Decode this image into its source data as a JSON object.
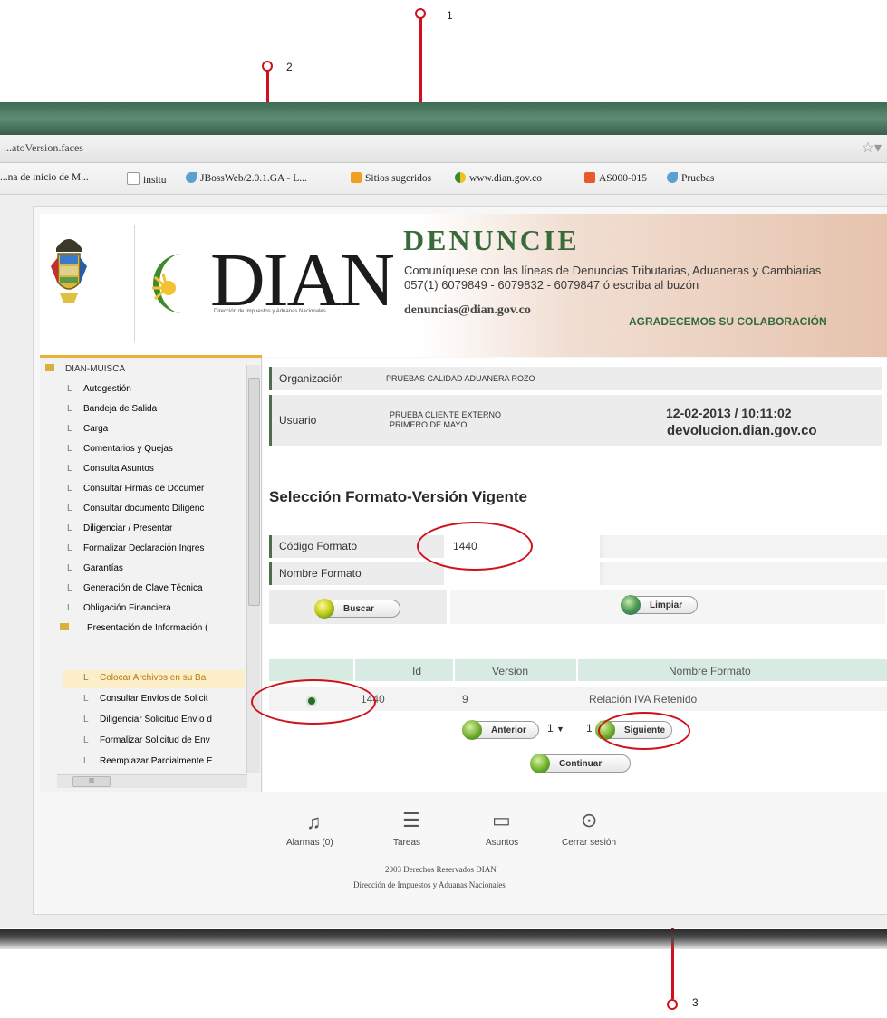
{
  "callouts": [
    "1",
    "2",
    "3"
  ],
  "browser": {
    "url": "...atoVersion.faces",
    "bookmarks": [
      "...na de inicio de M...",
      "insitu",
      "JBossWeb/2.0.1.GA - L...",
      "Sitios sugeridos",
      "www.dian.gov.co",
      "AS000-015",
      "Pruebas"
    ]
  },
  "banner": {
    "logo_text": "DIAN",
    "logo_subtitle": "Dirección de Impuestos y Aduanas Nacionales",
    "title": "DENUNCIE",
    "message": "Comuníquese con las líneas de Denuncias Tributarias, Aduaneras y Cambiarias 057(1) 6079849 - 6079832 - 6079847 ó escriba al buzón",
    "email": "denuncias@dian.gov.co",
    "thanks": "AGRADECEMOS SU COLABORACIÓN"
  },
  "sidebar": {
    "root": "DIAN-MUISCA",
    "items": [
      "Autogestión",
      "Bandeja de Salida",
      "Carga",
      "Comentarios y Quejas",
      "Consulta Asuntos",
      "Consultar Firmas de Documer",
      "Consultar documento Diligenc",
      "Diligenciar / Presentar",
      "Formalizar Declaración Ingres",
      "Garantías",
      "Generación de Clave Técnica",
      "Obligación Financiera"
    ],
    "folder": "Presentación de Información (",
    "subitems": [
      "Colocar Archivos en su Ba",
      "Consultar Envíos de Solicit",
      "Diligenciar Solicitud Envío d",
      "Formalizar Solicitud de Env",
      "Reemplazar Parcialmente E"
    ],
    "hscroll_label": "III"
  },
  "header": {
    "org_label": "Organización",
    "org_value": "PRUEBAS CALIDAD ADUANERA ROZO",
    "user_label": "Usuario",
    "user_value_line1": "PRUEBA CLIENTE EXTERNO",
    "user_value_line2": "PRIMERO DE MAYO",
    "datetime": "12-02-2013 / 10:11:02",
    "host": "devolucion.dian.gov.co"
  },
  "form": {
    "title": "Selección Formato-Versión Vigente",
    "codigo_label": "Código Formato",
    "codigo_value": "1440",
    "nombre_label": "Nombre Formato",
    "nombre_value": "",
    "buscar_label": "Buscar",
    "limpiar_label": "Limpiar"
  },
  "results": {
    "columns": [
      "",
      "Id",
      "Version",
      "Nombre Formato"
    ],
    "rows": [
      {
        "selected": true,
        "id": "1440",
        "version": "9",
        "nombre": "Relación IVA Retenido"
      }
    ],
    "pager": {
      "anterior": "Anterior",
      "page": "1",
      "total": "1",
      "siguiente": "Siguiente"
    },
    "continuar": "Continuar"
  },
  "footer": {
    "alarmas": "Alarmas (0)",
    "tareas": "Tareas",
    "asuntos": "Asuntos",
    "cerrar": "Cerrar sesión",
    "copyright_line1": "2003 Derechos Reservados DIAN",
    "copyright_line2": "Dirección de Impuestos y Aduanas Nacionales"
  },
  "colors": {
    "annotation": "#d0101a",
    "dian_green": "#3a6a3a",
    "table_header": "#d7ebe2"
  }
}
